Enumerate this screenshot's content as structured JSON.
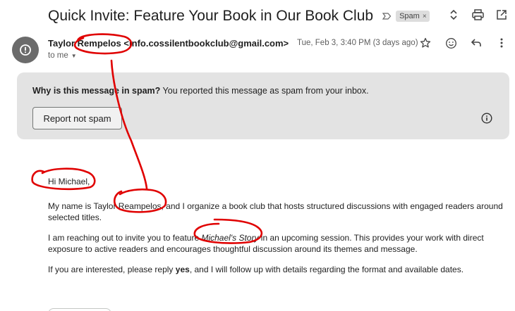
{
  "email": {
    "subject": "Quick Invite: Feature Your Book in Our Book Club",
    "label": "Spam",
    "label_remove": "×",
    "sender_name": "Taylor Rempelos",
    "sender_email": "<info.cossilentbookclub@gmail.com>",
    "recipient": "to me",
    "date": "Tue, Feb 3, 3:40 PM (3 days ago)"
  },
  "banner": {
    "question": "Why is this message in spam?",
    "explanation": " You reported this message as spam from your inbox.",
    "button": "Report not spam"
  },
  "message": {
    "greeting": "Hi Michael,",
    "p1": "My name is Taylor Reampelos, and I organize a book club that hosts structured discussions with engaged readers around selected titles.",
    "p2_before": "I am reaching out to invite you to feature ",
    "p2_title": "Michael's Story",
    "p2_after": " in an upcoming session. This provides your work with direct exposure to active readers and encourages thoughtful discussion around its themes and message.",
    "p3_before": "If you are interested, please reply ",
    "p3_bold": "yes",
    "p3_after": ", and I will follow up with details regarding the format and available dates."
  },
  "icons": {
    "header": [
      "chevron-updown-icon",
      "print-icon",
      "open-new-window-icon"
    ],
    "message": [
      "star-icon",
      "emoji-icon",
      "reply-icon",
      "more-vert-icon"
    ],
    "avatar": "alert-avatar-icon",
    "info": "info-icon"
  },
  "colors": {
    "annotation": "#e00000",
    "banner_bg": "#e3e3e3",
    "avatar_bg": "#6b6b6b"
  }
}
